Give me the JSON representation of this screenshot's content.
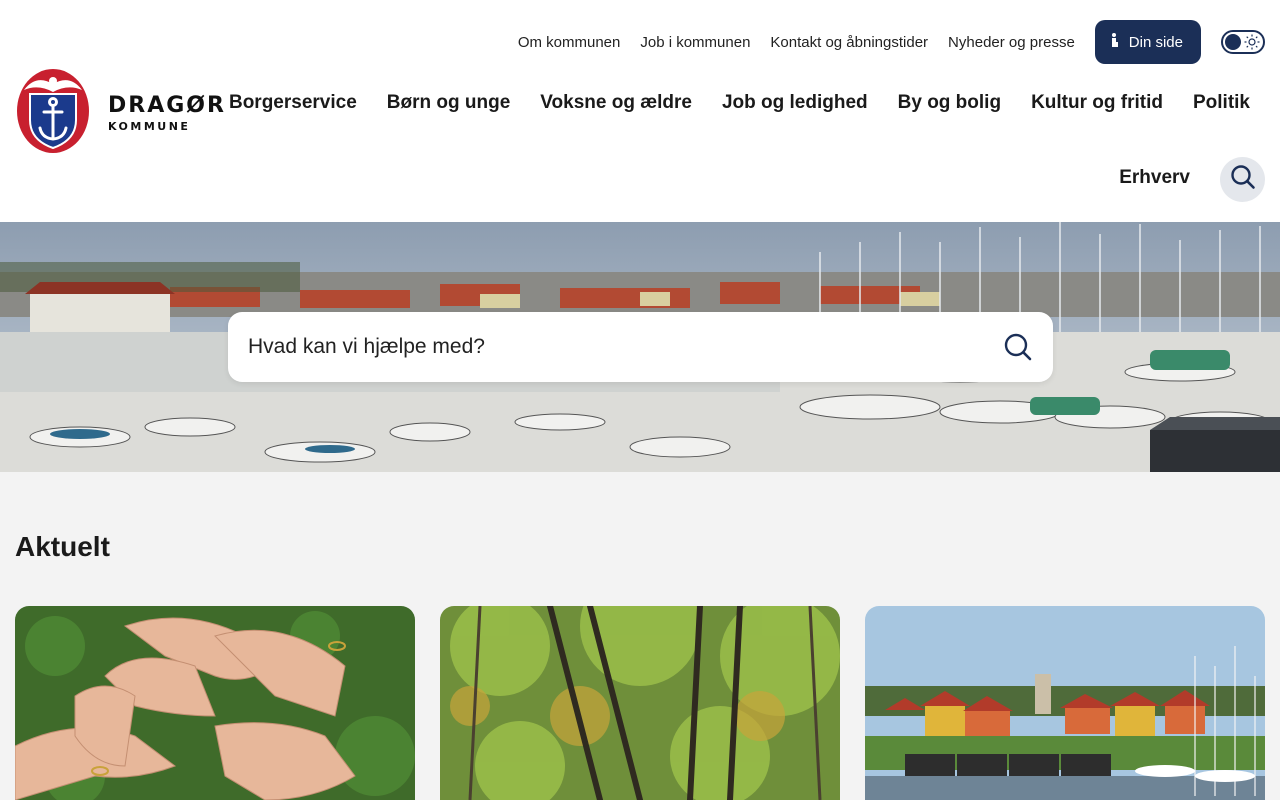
{
  "util_nav": {
    "links": [
      "Om kommunen",
      "Job i kommunen",
      "Kontakt og åbningstider",
      "Nyheder og presse"
    ],
    "din_side": "Din side"
  },
  "logo": {
    "name": "DRAGØR",
    "sub": "KOMMUNE"
  },
  "main_nav": {
    "items": [
      "Borgerservice",
      "Børn og unge",
      "Voksne og ældre",
      "Job og ledighed",
      "By og bolig",
      "Kultur og fritid",
      "Politik",
      "Erhverv"
    ]
  },
  "hero": {
    "search_placeholder": "Hvad kan vi hjælpe med?"
  },
  "aktuelt": {
    "title": "Aktuelt"
  },
  "colors": {
    "brand_navy": "#1b2f57",
    "logo_red": "#c8202f",
    "logo_blue": "#1b3a8c",
    "page_bg": "#f3f3f3"
  }
}
